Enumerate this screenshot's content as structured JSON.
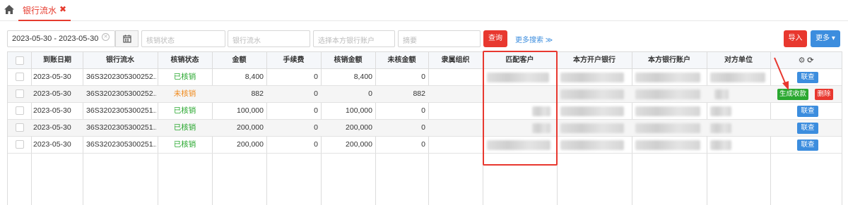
{
  "tabs": {
    "active_label": "银行流水",
    "close_glyph": "✖"
  },
  "filters": {
    "date_range": "2023-05-30 - 2023-05-30",
    "status_placeholder": "核销状态",
    "flow_placeholder": "银行流水",
    "account_placeholder": "选择本方银行账户",
    "summary_placeholder": "摘要",
    "query_label": "查询",
    "more_search_label": "更多搜索 ≫"
  },
  "toolbar": {
    "import_label": "导入",
    "more_label": "更多 ▾"
  },
  "table": {
    "headers": [
      "到账日期",
      "银行流水",
      "核销状态",
      "金额",
      "手续费",
      "核销金额",
      "未核金额",
      "隶属组织",
      "匹配客户",
      "本方开户银行",
      "本方银行账户",
      "对方单位"
    ],
    "rows": [
      {
        "date": "2023-05-30",
        "flow": "36S3202305300252...",
        "status": "已核销",
        "amount": "8,400",
        "fee": "0",
        "verified": "8,400",
        "unverified": "0",
        "actions": [
          "联查"
        ]
      },
      {
        "date": "2023-05-30",
        "flow": "36S3202305300252...",
        "status": "未核销",
        "amount": "882",
        "fee": "0",
        "verified": "0",
        "unverified": "882",
        "actions": [
          "生成收款",
          "删除"
        ]
      },
      {
        "date": "2023-05-30",
        "flow": "36S3202305300251...",
        "status": "已核销",
        "amount": "100,000",
        "fee": "0",
        "verified": "100,000",
        "unverified": "0",
        "actions": [
          "联查"
        ]
      },
      {
        "date": "2023-05-30",
        "flow": "36S3202305300251...",
        "status": "已核销",
        "amount": "200,000",
        "fee": "0",
        "verified": "200,000",
        "unverified": "0",
        "actions": [
          "联查"
        ]
      },
      {
        "date": "2023-05-30",
        "flow": "36S3202305300251...",
        "status": "已核销",
        "amount": "200,000",
        "fee": "0",
        "verified": "200,000",
        "unverified": "0",
        "actions": [
          "联查"
        ]
      }
    ]
  },
  "colors": {
    "accent_red": "#e8382f",
    "accent_blue": "#3c8dde",
    "status_green": "#2aa830",
    "status_orange": "#f08a1c"
  }
}
